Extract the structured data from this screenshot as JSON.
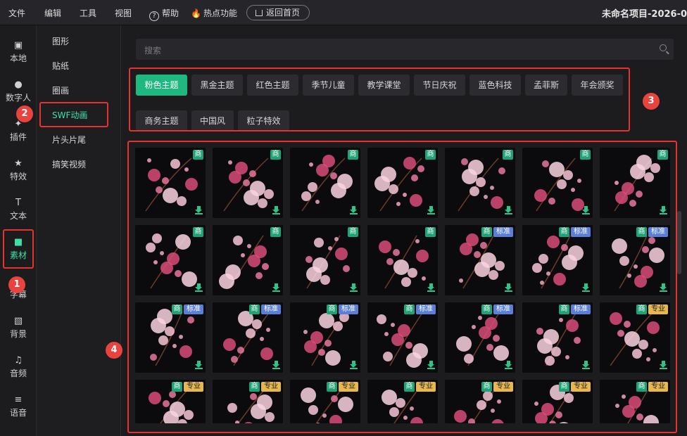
{
  "menu": {
    "file": "文件",
    "edit": "编辑",
    "tools": "工具",
    "view": "视图",
    "help": "帮助",
    "hot": "热点功能",
    "home": "返回首页",
    "project_title": "未命名项目-2026-0"
  },
  "left_nav": [
    {
      "label": "本地",
      "icon": "film-icon"
    },
    {
      "label": "数字人",
      "icon": "person-icon"
    },
    {
      "label": "插件",
      "icon": "puzzle-icon"
    },
    {
      "label": "特效",
      "icon": "star-icon"
    },
    {
      "label": "文本",
      "icon": "text-icon"
    },
    {
      "label": "素材",
      "icon": "folder-icon",
      "active": true
    },
    {
      "label": "字幕",
      "icon": "subtitle-icon"
    },
    {
      "label": "背景",
      "icon": "background-icon"
    },
    {
      "label": "音频",
      "icon": "music-icon"
    },
    {
      "label": "语音",
      "icon": "voice-icon"
    }
  ],
  "sub_nav": [
    "图形",
    "贴纸",
    "圈画",
    "SWF动画",
    "片头片尾",
    "搞笑视频"
  ],
  "search": {
    "placeholder": "搜索"
  },
  "tabs": [
    "粉色主题",
    "黑金主题",
    "红色主题",
    "季节儿童",
    "教学课堂",
    "节日庆祝",
    "蓝色科技",
    "孟菲斯",
    "年会颁奖",
    "商务主题",
    "中国风",
    "粒子特效"
  ],
  "badges": {
    "commercial": "商",
    "standard": "标准",
    "pro": "专业"
  },
  "grid_rows": [
    [
      "commercial",
      "commercial",
      "commercial",
      "commercial",
      "commercial",
      "commercial",
      "commercial"
    ],
    [
      "commercial",
      "commercial",
      "commercial",
      "commercial",
      "standard",
      "standard",
      "standard"
    ],
    [
      "standard",
      "standard",
      "standard",
      "standard",
      "standard",
      "standard",
      "pro"
    ],
    [
      "pro",
      "pro",
      "pro",
      "pro",
      "pro",
      "pro",
      "pro"
    ]
  ],
  "annotations": [
    "1",
    "2",
    "3",
    "4"
  ],
  "colors": {
    "accent": "#1fb880",
    "highlight": "#e5342f",
    "badge_commercial": "#1fa276",
    "badge_standard": "#5b7fd8",
    "badge_pro": "#e8b84c"
  }
}
